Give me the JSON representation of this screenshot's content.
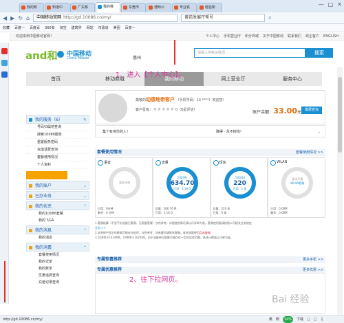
{
  "browser": {
    "tabs": [
      {
        "label": "我的知"
      },
      {
        "label": "知道中"
      },
      {
        "label": "广东移"
      },
      {
        "label": "我的移",
        "active": true
      },
      {
        "label": "东莞市"
      },
      {
        "label": "通知公"
      },
      {
        "label": "专业铁"
      },
      {
        "label": "经验新"
      }
    ],
    "window_controls": [
      "—",
      "□",
      "✕"
    ],
    "url_domain": "中国移动官网",
    "url": "http://gd.10086.cn/my/",
    "search_value": "黄芭发展厅帮号",
    "favorites": [
      "收藏",
      "百度一",
      "百度百",
      "360安",
      "淘宝",
      "建筑界",
      "网站",
      "市政道",
      "美团",
      "百度一"
    ]
  },
  "topinfo": {
    "left": "欢迎来到中国移动官网！",
    "links": [
      "个人中心",
      "手机营业厅",
      "积分商城",
      "关于中国移动",
      "联系我们",
      "政企客户",
      "ENGLISH"
    ]
  },
  "header": {
    "logo_and": "and和",
    "logo_cn": "中国移动",
    "logo_en": "China Mobile",
    "city": "惠州",
    "search_placeholder": "请输入搜索关键词",
    "search_button": "搜索"
  },
  "mainnav": [
    {
      "label": "首页"
    },
    {
      "label": "移动商城"
    },
    {
      "label": "我的移动",
      "active": true
    },
    {
      "label": "网上营业厅"
    },
    {
      "label": "服务中心"
    }
  ],
  "annotations": {
    "step1": "1、进入【个人中心】。",
    "step2": "2、往下拉网页。"
  },
  "sidebar": {
    "my_services_title": "我的服务（6）",
    "my_services": [
      "号码归属地查询",
      "搜索10086服务",
      "重置服务密码",
      "充值话费查询",
      "套餐使用情况",
      "个人资料"
    ],
    "groups": [
      {
        "title": "我的账户",
        "color": "y"
      },
      {
        "title": "已办业务",
        "color": "y"
      },
      {
        "title": "我的优充",
        "color": "y"
      }
    ],
    "recharge_items": [
      "我的10086套餐",
      "我的飞GA"
    ],
    "my_msg": "我的消息",
    "my_msg_items": [
      "我的消息"
    ],
    "my_query": "我的消费",
    "query_items": [
      "套餐使用情况",
      "我的详单",
      "我的账单",
      "优惠话费查询",
      "充值记录查询"
    ]
  },
  "customer": {
    "greeting": "尊敬的",
    "name": "动感地带客户",
    "phone": "（手机号码：13   ****）",
    "welcome": "欢迎您！",
    "level_label": "客户星级：",
    "stars": "★★★★★",
    "level_note": "0（6星评估）",
    "balance_label": "账户余额：",
    "balance": "33.00",
    "balance_unit": "元",
    "pay_button": "缴费查询"
  },
  "notes": {
    "left": "集个有身份的人！",
    "right": "赚得 · 永不掉线！"
  },
  "usage": {
    "title": "套餐使用情况",
    "more": "套餐使用情况 >>",
    "cards": [
      {
        "name": "语音",
        "type": "grey",
        "main": "暂未开通",
        "f1": "已用：0分钟",
        "f2": "剩余：0 分钟"
      },
      {
        "name": "流量",
        "type": "blue",
        "label": "可用(M)",
        "value": "634.70",
        "sub": "已用：1.16 G",
        "f1": "总量：566.76 M",
        "f2": "已用：1.16 G"
      },
      {
        "name": "短信",
        "type": "blue",
        "label": "可用(条)",
        "value": "220",
        "sub": "已用：1 条",
        "f1": "总量：220 条",
        "f2": "已用：0 条"
      },
      {
        "name": "WLAN",
        "type": "grey",
        "main": "暂未开通",
        "sub": "WLAN套餐",
        "f1": "已用：0.00M",
        "f2": "剩余：0.00M"
      }
    ]
  },
  "notice": {
    "l1": "1.套餐结算（不含手机流量日套餐、无限量套餐）仅供参考，详细使用情况请以月详单为准。套餐使用量请按照公司相关业务规定",
    "l1b": "业务 >>",
    "l2": "2.本系统中显示的数据可能存在延时，仅供参考，如有疑问请联系客服。查询流量使用",
    "l2hl": "点击查询",
    "l3": "3.1GB等于1024MB，1MB等于1024KB，由于流量单位换算可能存在一定的误差范围，具体计费请以详单为准。"
  },
  "sections": {
    "s1": "专属惊喜推荐",
    "s1more": "更多手机 >>",
    "s2": "专属优惠推荐",
    "s2more": "更多优惠 >>"
  },
  "status": {
    "url": "http://gd.10086.cn/my/",
    "pct": "34%",
    "icons": [
      "英",
      "网",
      "下载",
      "▢",
      "□",
      "♫"
    ]
  },
  "watermark": "Bai 经验",
  "colors": {
    "accent": "#1a8fd1",
    "orange": "#e36c09",
    "annotation": "#d63a9a"
  }
}
